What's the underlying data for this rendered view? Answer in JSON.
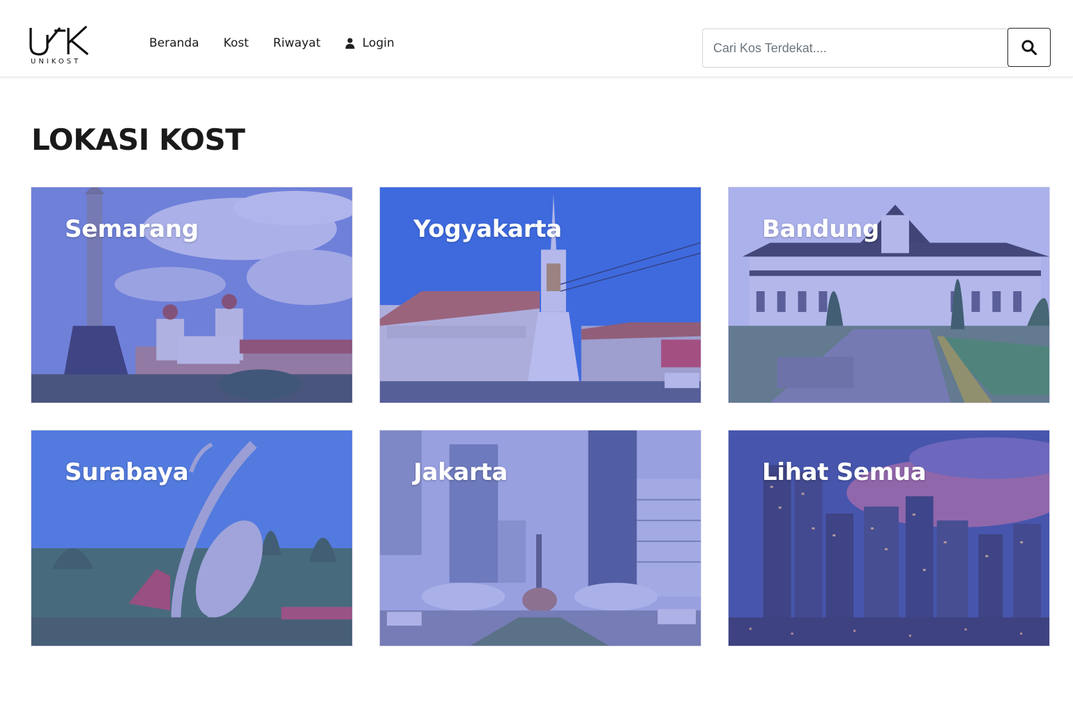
{
  "header": {
    "logo_text": "UNIKOST",
    "nav": [
      {
        "label": "Beranda"
      },
      {
        "label": "Kost"
      },
      {
        "label": "Riwayat"
      },
      {
        "label": "Login",
        "icon": "user-icon"
      }
    ],
    "search": {
      "placeholder": "Cari Kos Terdekat....",
      "value": "",
      "button_icon": "search-icon"
    }
  },
  "main": {
    "title": "LOKASI KOST",
    "locations": [
      {
        "label": "Semarang"
      },
      {
        "label": "Yogyakarta"
      },
      {
        "label": "Bandung"
      },
      {
        "label": "Surabaya"
      },
      {
        "label": "Jakarta"
      },
      {
        "label": "Lihat Semua"
      }
    ]
  },
  "colors": {
    "overlay": "#5a64dc",
    "text_dark": "#1a1a1a",
    "label_text": "#ffffff"
  }
}
